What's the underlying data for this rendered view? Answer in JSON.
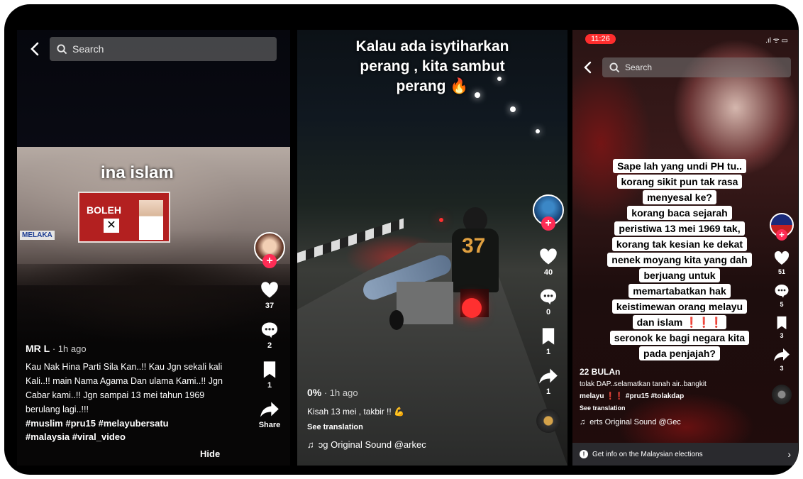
{
  "panel1": {
    "search_placeholder": "Search",
    "video_caption": "ina islam",
    "sign_text_1": "BOLEH",
    "sign_text_2": "MELAKA",
    "likes": "37",
    "comments": "2",
    "saves": "1",
    "share_label": "Share",
    "username": "MR L",
    "time": "· 1h ago",
    "caption": "Kau Nak Hina Parti Sila Kan..!! Kau Jgn sekali kali Kali..!! main Nama Agama Dan ulama Kami..!! Jgn Cabar kami..!! Jgn sampai 13 mei tahun 1969 berulang lagi..!!!",
    "hashtags_line1": "#muslim #pru15 #melayubersatu",
    "hashtags_line2": "#malaysia #viral_video",
    "hide_label": "Hide"
  },
  "panel2": {
    "overlay_line1": "Kalau ada isytiharkan",
    "overlay_line2": "perang , kita sambut",
    "overlay_line3": "perang 🔥",
    "jersey_number": "37",
    "likes": "40",
    "comments": "0",
    "saves": "1",
    "shares": "1",
    "username": "0%",
    "time": "· 1h ago",
    "caption": "Kisah 13 mei , takbir !! 💪",
    "see_translation": "See translation",
    "sound": "ɔg Original Sound    @arkec"
  },
  "panel3": {
    "clock": "11:26",
    "status_icons": ".ıl ᯤ ▭",
    "search_placeholder": "Search",
    "overlay_lines": [
      "Sape lah yang undi PH tu..",
      "korang sikit pun tak rasa",
      "menyesal ke?",
      "korang baca sejarah",
      "peristiwa 13 mei 1969 tak,",
      "korang tak kesian ke dekat",
      "nenek moyang kita yang dah",
      "berjuang untuk",
      "memartabatkan hak",
      "keistimewan orang melayu",
      "dan islam ❗❗❗",
      "seronok ke bagi negara kita",
      "pada penjajah?"
    ],
    "likes": "51",
    "comments": "5",
    "saves": "3",
    "shares": "3",
    "username": "22 BULAn",
    "caption_line1": "tolak DAP..selamatkan tanah air..bangkit",
    "caption_line2": "melayu ❗❗ #pru15 #tolakdap",
    "see_translation": "See translation",
    "sound": "erts Original Sound    @Gec",
    "info_banner": "Get info on the Malaysian elections"
  },
  "colors": {
    "tiktok_red": "#fe2c55",
    "frame": "#000000"
  }
}
